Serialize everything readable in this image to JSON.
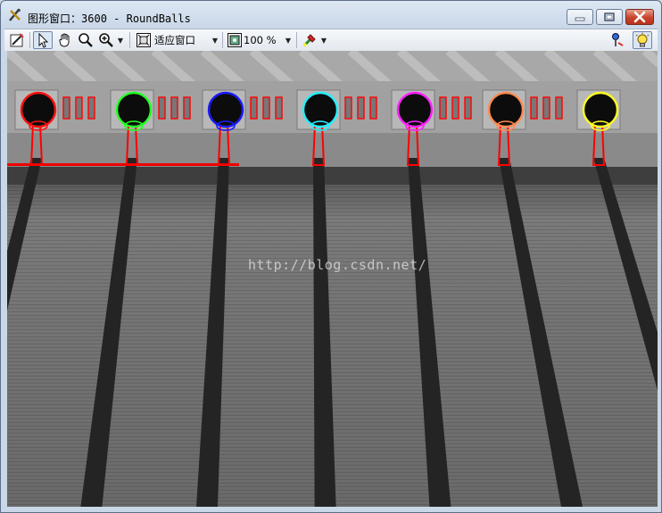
{
  "window": {
    "title_prefix": "图形窗口：",
    "title_rest": "3600 - RoundBalls"
  },
  "toolbar": {
    "fit_label": "适应窗口",
    "zoom_label": "100 %"
  },
  "canvas": {
    "watermark": "http://blog.csdn.net/",
    "ball_colors": [
      "#ff1010",
      "#22ff22",
      "#1a1aff",
      "#22f0ff",
      "#ff20ff",
      "#ff8a50",
      "#ffff22"
    ],
    "contour_color": "#ff0000"
  },
  "icons": [
    "app-icon",
    "edit-icon",
    "pointer-icon",
    "hand-icon",
    "zoom-icon",
    "zoom-plus-icon",
    "fit-window-icon",
    "zoom-level-icon",
    "paint-icon",
    "pin-icon",
    "bulb-icon"
  ]
}
